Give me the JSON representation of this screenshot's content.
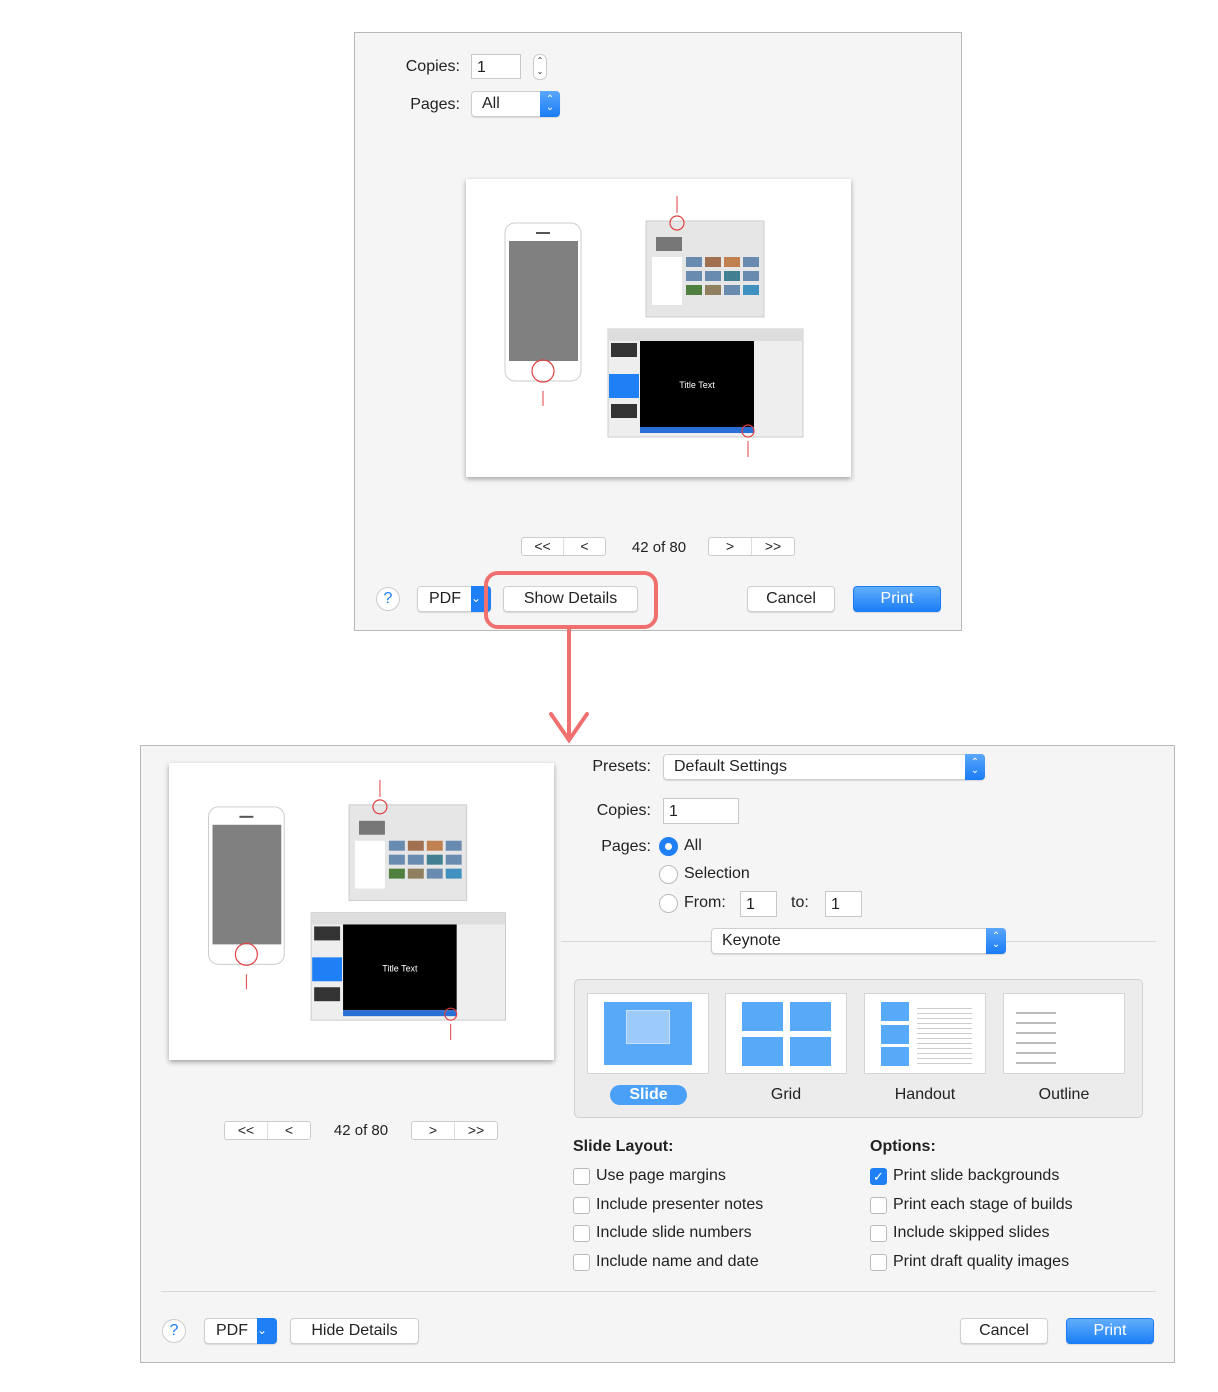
{
  "simple_dialog": {
    "copies_label": "Copies:",
    "copies_value": "1",
    "pages_label": "Pages:",
    "pages_value": "All",
    "nav": {
      "first": "<<",
      "prev": "<",
      "page_indicator": "42 of 80",
      "next": ">",
      "last": ">>"
    },
    "help": "?",
    "pdf": "PDF",
    "show_details": "Show Details",
    "cancel": "Cancel",
    "print": "Print"
  },
  "preview": {
    "slide_title": "Title Text"
  },
  "detail_dialog": {
    "presets_label": "Presets:",
    "presets_value": "Default Settings",
    "copies_label": "Copies:",
    "copies_value": "1",
    "pages_label": "Pages:",
    "pages_all": "All",
    "pages_selection": "Selection",
    "pages_from": "From:",
    "from_value": "1",
    "to_label": "to:",
    "to_value": "1",
    "app_section": "Keynote",
    "layouts": [
      {
        "label": "Slide",
        "selected": true
      },
      {
        "label": "Grid",
        "selected": false
      },
      {
        "label": "Handout",
        "selected": false
      },
      {
        "label": "Outline",
        "selected": false
      }
    ],
    "slide_layout_header": "Slide Layout:",
    "slide_layout_options": [
      {
        "label": "Use page margins",
        "checked": false
      },
      {
        "label": "Include presenter notes",
        "checked": false
      },
      {
        "label": "Include slide numbers",
        "checked": false
      },
      {
        "label": "Include name and date",
        "checked": false
      }
    ],
    "options_header": "Options:",
    "options": [
      {
        "label": "Print slide backgrounds",
        "checked": true
      },
      {
        "label": "Print each stage of builds",
        "checked": false
      },
      {
        "label": "Include skipped slides",
        "checked": false
      },
      {
        "label": "Print draft quality images",
        "checked": false
      }
    ],
    "nav": {
      "first": "<<",
      "prev": "<",
      "page_indicator": "42 of 80",
      "next": ">",
      "last": ">>"
    },
    "help": "?",
    "pdf": "PDF",
    "hide_details": "Hide Details",
    "cancel": "Cancel",
    "print": "Print"
  },
  "colors": {
    "accent": "#1f7ff5",
    "highlight": "#f07070"
  }
}
